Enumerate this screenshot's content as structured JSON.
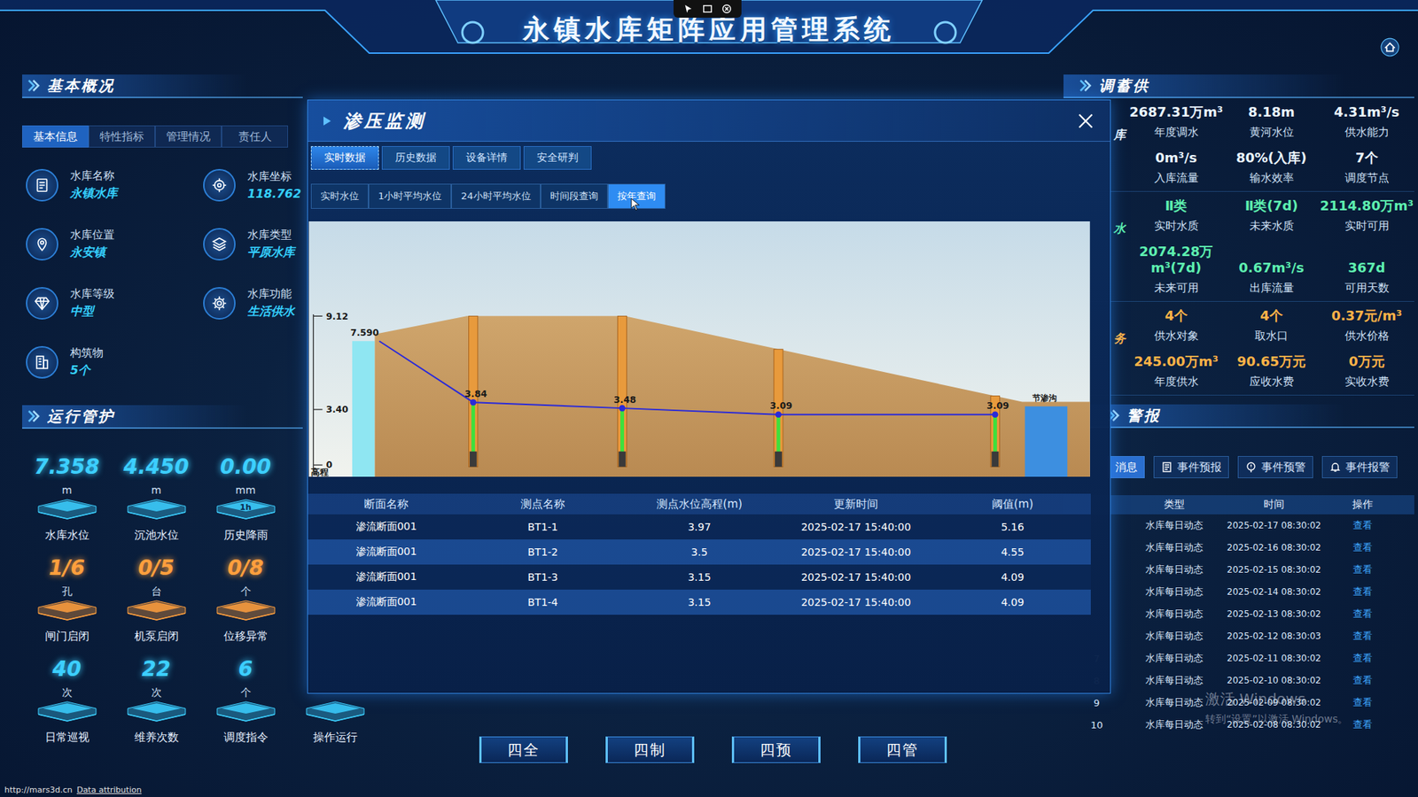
{
  "header": {
    "title": "永镇水库矩阵应用管理系统"
  },
  "basic": {
    "title": "基本概况",
    "tabs": [
      {
        "label": "基本信息",
        "selected": true
      },
      {
        "label": "特性指标",
        "selected": false
      },
      {
        "label": "管理情况",
        "selected": false
      },
      {
        "label": "责任人",
        "selected": false
      }
    ],
    "items": [
      {
        "label": "水库名称",
        "value": "永镇水库"
      },
      {
        "label": "水库坐标",
        "value": "118.762"
      },
      {
        "label": "水库位置",
        "value": "永安镇"
      },
      {
        "label": "水库类型",
        "value": "平原水库"
      },
      {
        "label": "水库等级",
        "value": "中型"
      },
      {
        "label": "水库功能",
        "value": "生活供水"
      },
      {
        "label": "构筑物",
        "value": "5个"
      }
    ]
  },
  "operation": {
    "title": "运行管护",
    "rows": [
      [
        {
          "value": "7.358",
          "unit": "m",
          "label": "水库水位",
          "color": "#3ccfff"
        },
        {
          "value": "4.450",
          "unit": "m",
          "label": "沉池水位",
          "color": "#3ccfff"
        },
        {
          "value": "0.00",
          "unit": "mm",
          "badge": "1h",
          "label": "历史降雨",
          "color": "#3ccfff"
        }
      ],
      [
        {
          "value": "1/6",
          "unit": "孔",
          "label": "闸门启闭",
          "color": "#ff9f3d"
        },
        {
          "value": "0/5",
          "unit": "台",
          "label": "机泵启闭",
          "color": "#ff9f3d"
        },
        {
          "value": "0/8",
          "unit": "个",
          "label": "位移异常",
          "color": "#ff9f3d"
        }
      ],
      [
        {
          "value": "40",
          "unit": "次",
          "label": "日常巡视",
          "color": "#3ccfff"
        },
        {
          "value": "22",
          "unit": "次",
          "label": "维养次数",
          "color": "#3ccfff"
        },
        {
          "value": "6",
          "unit": "个",
          "label": "调度指令",
          "color": "#3ccfff"
        },
        {
          "label": "操作运行",
          "color": "#3ccfff"
        }
      ]
    ]
  },
  "supply": {
    "title": "调蓄供",
    "sections": [
      {
        "side": "库",
        "color": "#eaf5ff",
        "stats": [
          {
            "value": "2687.31万m³",
            "label": "年度调水"
          },
          {
            "value": "8.18m",
            "label": "黄河水位"
          },
          {
            "value": "4.31m³/s",
            "label": "供水能力"
          },
          {
            "value": "0m³/s",
            "label": "入库流量"
          },
          {
            "value": "80%(入库)",
            "label": "输水效率"
          },
          {
            "value": "7个",
            "label": "调度节点"
          }
        ]
      },
      {
        "side": "水",
        "color": "#5ef0b0",
        "stats": [
          {
            "value": "Ⅱ类",
            "label": "实时水质"
          },
          {
            "value": "Ⅱ类(7d)",
            "label": "未来水质"
          },
          {
            "value": "2114.80万m³",
            "label": "实时可用"
          },
          {
            "value": "2074.28万m³(7d)",
            "label": "未来可用"
          },
          {
            "value": "0.67m³/s",
            "label": "出库流量"
          },
          {
            "value": "367d",
            "label": "可用天数"
          }
        ]
      },
      {
        "side": "务",
        "color": "#ffb347",
        "stats": [
          {
            "value": "4个",
            "label": "供水对象"
          },
          {
            "value": "4个",
            "label": "取水口"
          },
          {
            "value": "0.37元/m³",
            "label": "供水价格"
          },
          {
            "value": "245.00万m³",
            "label": "年度供水"
          },
          {
            "value": "90.65万元",
            "label": "应收水费"
          },
          {
            "value": "0万元",
            "label": "实收水费"
          }
        ]
      }
    ]
  },
  "alerts": {
    "title": "警报",
    "tabs": [
      {
        "label": "消息",
        "selected": true
      },
      {
        "label": "事件预报",
        "selected": false
      },
      {
        "label": "事件预警",
        "selected": false
      },
      {
        "label": "事件报警",
        "selected": false
      }
    ],
    "columns": [
      "类型",
      "时间",
      "操作"
    ],
    "rows": [
      {
        "index": "",
        "type": "水库每日动态",
        "time": "2025-02-17 08:30:02",
        "action": "查看"
      },
      {
        "index": "",
        "type": "水库每日动态",
        "time": "2025-02-16 08:30:02",
        "action": "查看"
      },
      {
        "index": "",
        "type": "水库每日动态",
        "time": "2025-02-15 08:30:02",
        "action": "查看"
      },
      {
        "index": "",
        "type": "水库每日动态",
        "time": "2025-02-14 08:30:02",
        "action": "查看"
      },
      {
        "index": "",
        "type": "水库每日动态",
        "time": "2025-02-13 08:30:02",
        "action": "查看"
      },
      {
        "index": "",
        "type": "水库每日动态",
        "time": "2025-02-12 08:30:03",
        "action": "查看"
      },
      {
        "index": "7",
        "type": "水库每日动态",
        "time": "2025-02-11 08:30:02",
        "action": "查看"
      },
      {
        "index": "8",
        "type": "水库每日动态",
        "time": "2025-02-10 08:30:02",
        "action": "查看"
      },
      {
        "index": "9",
        "type": "水库每日动态",
        "time": "2025-02-09 08:30:02",
        "action": "查看"
      },
      {
        "index": "10",
        "type": "水库每日动态",
        "time": "2025-02-08 08:30:02",
        "action": "查看"
      }
    ]
  },
  "modal": {
    "title": "渗压监测",
    "tabs": [
      {
        "label": "实时数据",
        "selected": true
      },
      {
        "label": "历史数据",
        "selected": false
      },
      {
        "label": "设备详情",
        "selected": false
      },
      {
        "label": "安全研判",
        "selected": false
      }
    ],
    "subtabs": [
      {
        "label": "实时水位",
        "selected": false
      },
      {
        "label": "1小时平均水位",
        "selected": false
      },
      {
        "label": "24小时平均水位",
        "selected": false
      },
      {
        "label": "时间段查询",
        "selected": false
      },
      {
        "label": "按年查询",
        "selected": true
      }
    ],
    "chart": {
      "y_ticks": [
        "9.12",
        "3.40",
        "0"
      ],
      "y_label": "高程",
      "upstream": {
        "label": "7.590",
        "value": 7.59
      },
      "probes": [
        {
          "label": "3.84",
          "value": 3.84
        },
        {
          "label": "3.48",
          "value": 3.48
        },
        {
          "label": "3.09",
          "value": 3.09
        },
        {
          "label": "3.09",
          "value": 3.09
        }
      ],
      "ditch_label": "节渗沟"
    },
    "table": {
      "columns": [
        "断面名称",
        "测点名称",
        "测点水位高程(m)",
        "更新时间",
        "阈值(m)"
      ],
      "rows": [
        [
          "渗流断面001",
          "BT1-1",
          "3.97",
          "2025-02-17 15:40:00",
          "5.16"
        ],
        [
          "渗流断面001",
          "BT1-2",
          "3.5",
          "2025-02-17 15:40:00",
          "4.55"
        ],
        [
          "渗流断面001",
          "BT1-3",
          "3.15",
          "2025-02-17 15:40:00",
          "4.09"
        ],
        [
          "渗流断面001",
          "BT1-4",
          "3.15",
          "2025-02-17 15:40:00",
          "4.09"
        ]
      ]
    }
  },
  "nav": [
    "四全",
    "四制",
    "四预",
    "四管"
  ],
  "attribution": {
    "url": "http://mars3d.cn",
    "link": "Data attribution"
  },
  "watermark": {
    "line1": "激活 Windows",
    "line2": "转到“设置”以激活 Windows。"
  }
}
